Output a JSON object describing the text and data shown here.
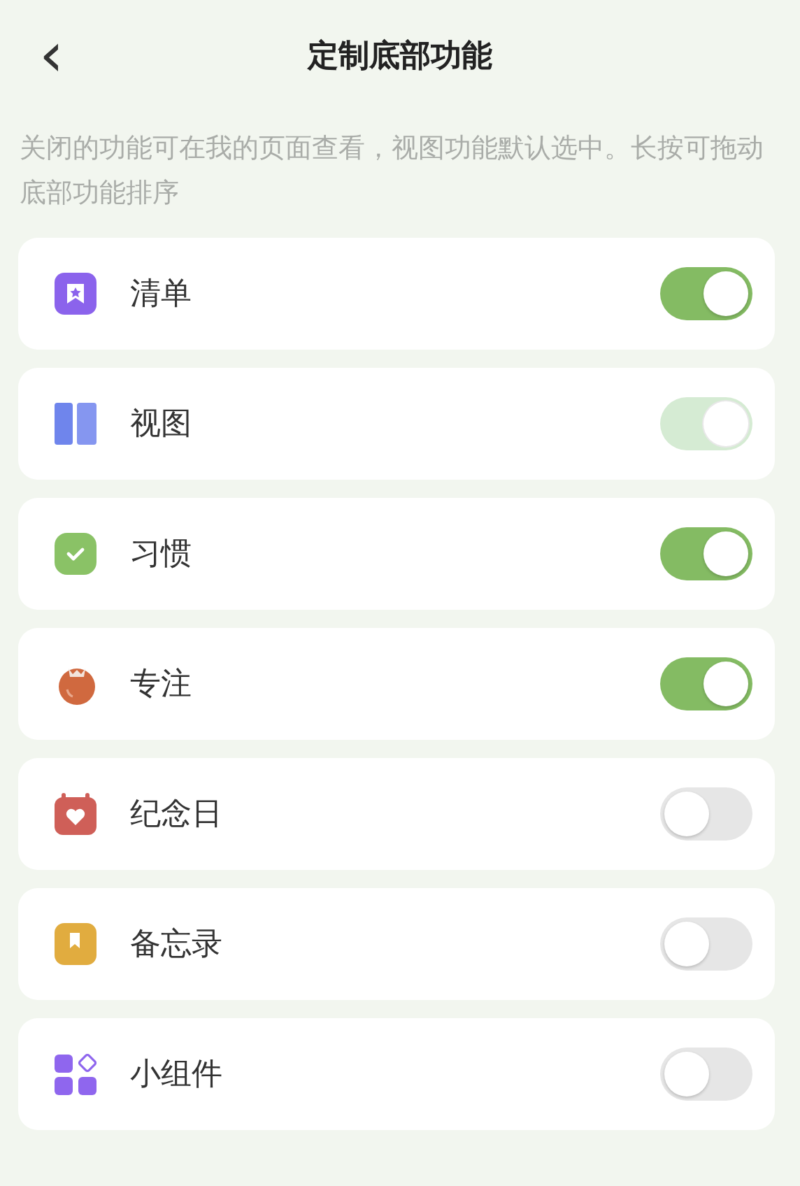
{
  "header": {
    "back": "‹",
    "title": "定制底部功能"
  },
  "description": "关闭的功能可在我的页面查看，视图功能默认选中。长按可拖动底部功能排序",
  "items": [
    {
      "label": "清单",
      "on": true,
      "disabled": false
    },
    {
      "label": "视图",
      "on": true,
      "disabled": true
    },
    {
      "label": "习惯",
      "on": true,
      "disabled": false
    },
    {
      "label": "专注",
      "on": true,
      "disabled": false
    },
    {
      "label": "纪念日",
      "on": false,
      "disabled": false
    },
    {
      "label": "备忘录",
      "on": false,
      "disabled": false
    },
    {
      "label": "小组件",
      "on": false,
      "disabled": false
    }
  ]
}
